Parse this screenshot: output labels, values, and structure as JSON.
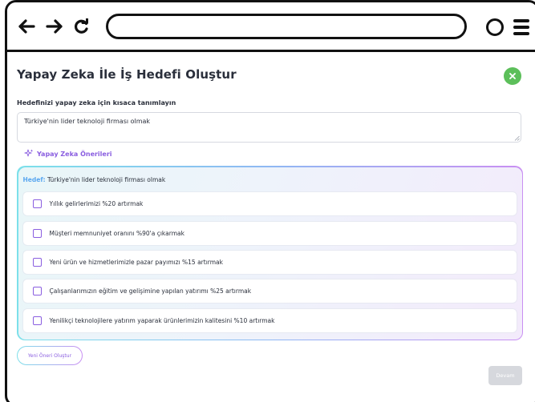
{
  "browser": {
    "back_icon": "arrow-left-icon",
    "forward_icon": "arrow-right-icon",
    "reload_icon": "reload-icon",
    "profile_icon": "profile-circle-icon",
    "menu_icon": "hamburger-menu-icon",
    "url": ""
  },
  "modal": {
    "title": "Yapay Zeka İle İş Hedefi Oluştur",
    "close_icon": "close-icon",
    "field_label": "Hedefinizi yapay zeka için kısaca tanımlayın",
    "field_value": "Türkiye'nin lider teknoloji firması olmak",
    "ai_suggestions_label": "Yapay Zeka Önerileri",
    "ai_icon": "sparkle-icon",
    "goal_prefix": "Hedef:",
    "goal_text": " Türkiye'nin lider teknoloji firması olmak",
    "options": [
      {
        "label": "Yıllık gelirlerimizi %20 artırmak",
        "checked": false
      },
      {
        "label": "Müşteri memnuniyet oranını %90'a çıkarmak",
        "checked": false
      },
      {
        "label": "Yeni ürün ve hizmetlerimizle pazar payımızı %15 artırmak",
        "checked": false
      },
      {
        "label": "Çalışanlarımızın eğitim ve gelişimine yapılan yatırımı %25 artırmak",
        "checked": false
      },
      {
        "label": "Yenilikçi teknolojilere yatırım yaparak ürünlerimizin kalitesini %10 artırmak",
        "checked": false
      }
    ],
    "new_suggestion_label": "Yeni Öneri Oluştur",
    "continue_label": "Devam"
  },
  "colors": {
    "accent_purple": "#8a5ee0",
    "accent_blue": "#5aa7f0",
    "close_green": "#5cbf5a",
    "disabled_gray": "#d6d8dd"
  }
}
